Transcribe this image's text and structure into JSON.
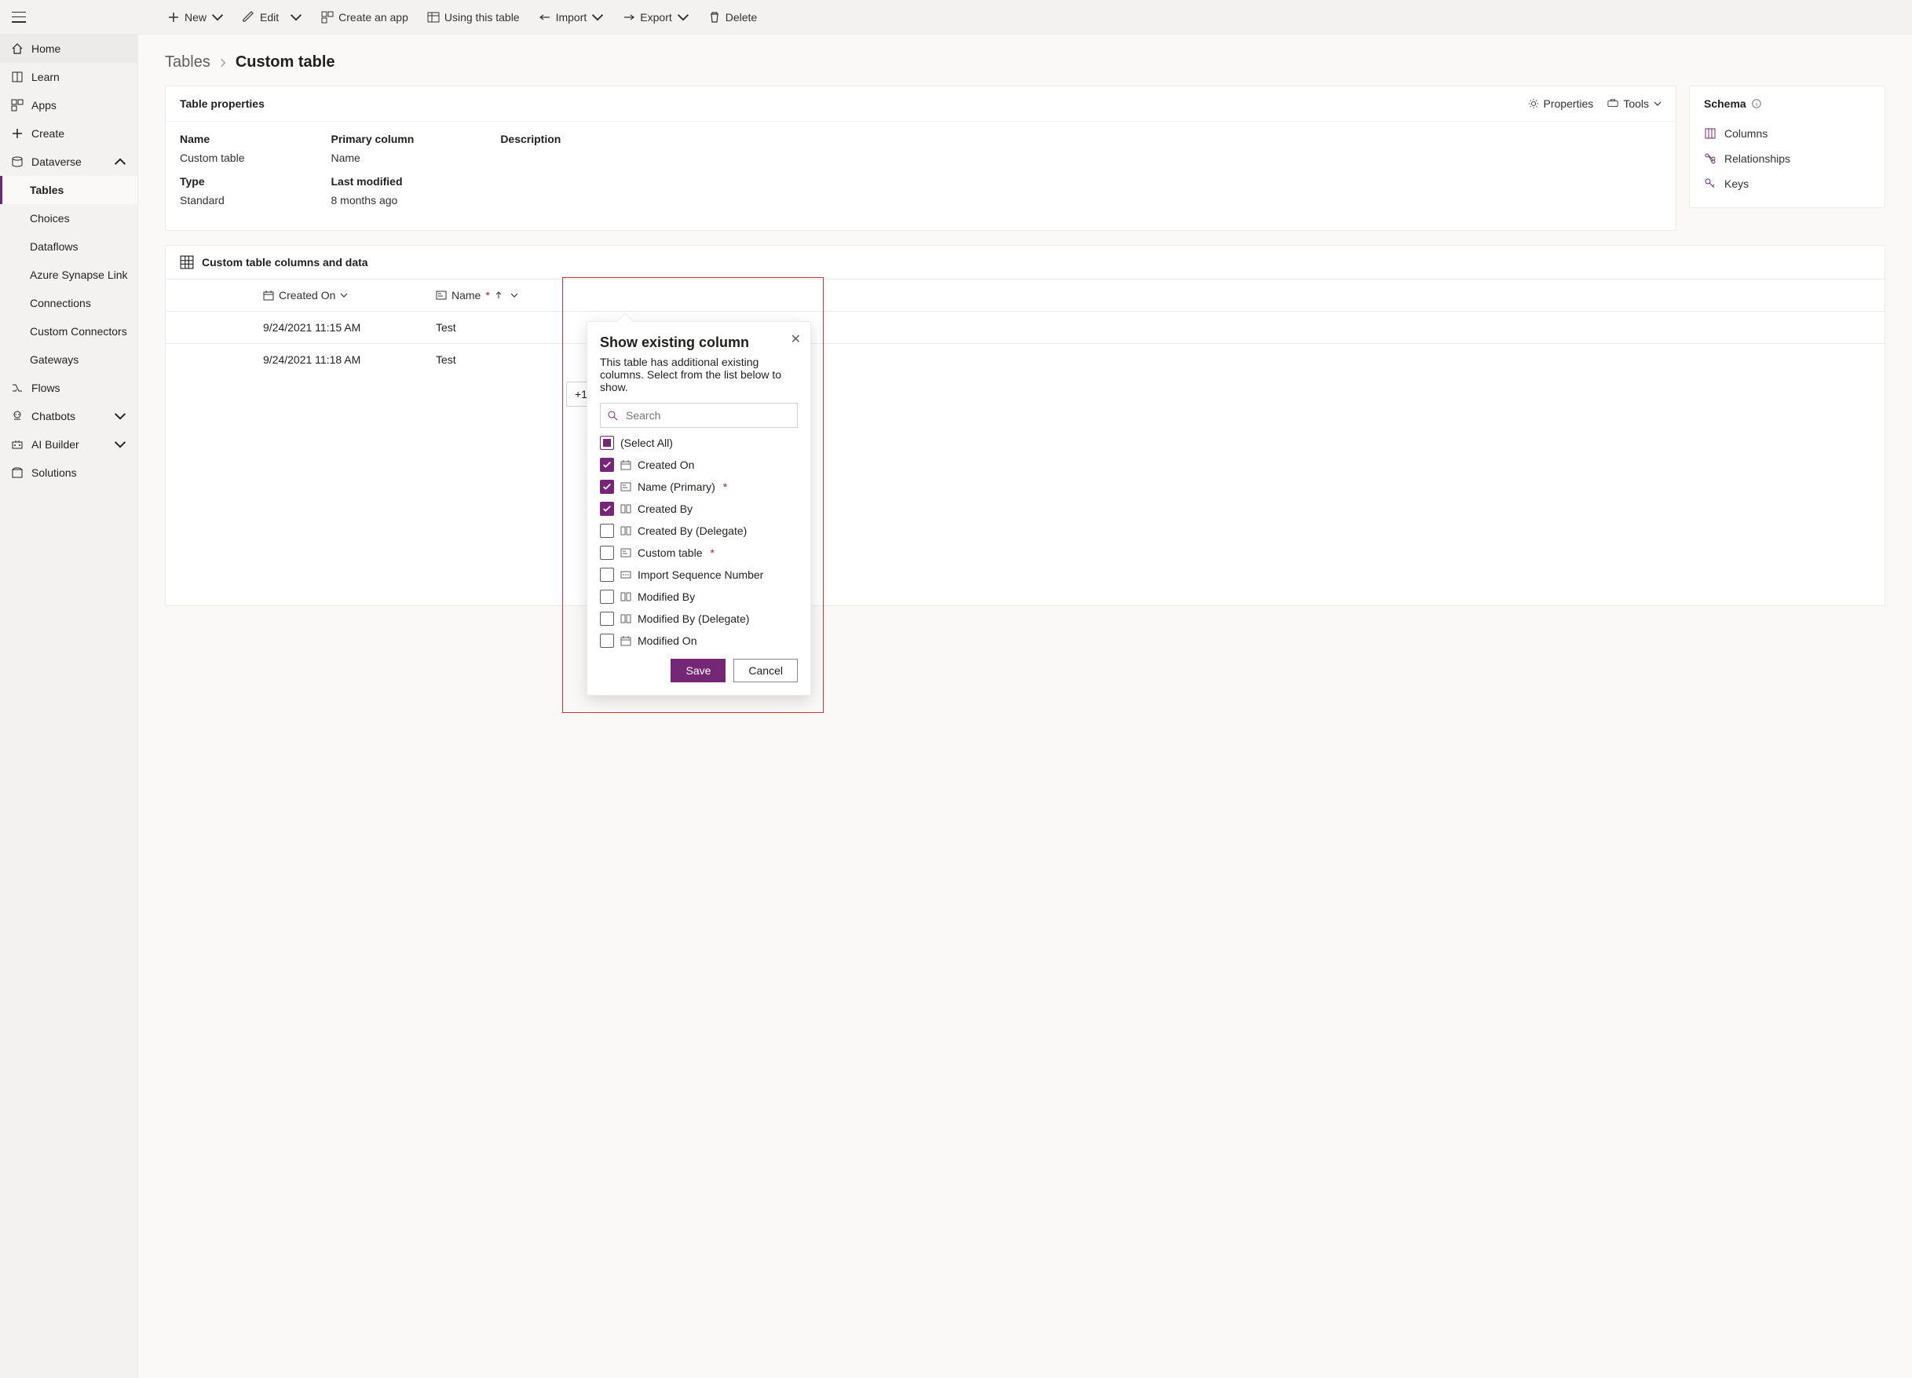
{
  "toolbar": {
    "new": "New",
    "edit": "Edit",
    "create_app": "Create an app",
    "using_table": "Using this table",
    "import": "Import",
    "export": "Export",
    "delete": "Delete"
  },
  "nav": {
    "home": "Home",
    "learn": "Learn",
    "apps": "Apps",
    "create": "Create",
    "dataverse": "Dataverse",
    "tables": "Tables",
    "choices": "Choices",
    "dataflows": "Dataflows",
    "synapse": "Azure Synapse Link",
    "connections": "Connections",
    "custom_connectors": "Custom Connectors",
    "gateways": "Gateways",
    "flows": "Flows",
    "chatbots": "Chatbots",
    "ai_builder": "AI Builder",
    "solutions": "Solutions"
  },
  "breadcrumb": {
    "root": "Tables",
    "current": "Custom table"
  },
  "props": {
    "title": "Table properties",
    "properties_btn": "Properties",
    "tools_btn": "Tools",
    "name_label": "Name",
    "name_val": "Custom table",
    "primary_label": "Primary column",
    "primary_val": "Name",
    "desc_label": "Description",
    "desc_val": "",
    "type_label": "Type",
    "type_val": "Standard",
    "lastmod_label": "Last modified",
    "lastmod_val": "8 months ago"
  },
  "schema": {
    "title": "Schema",
    "columns": "Columns",
    "relationships": "Relationships",
    "keys": "Keys"
  },
  "data": {
    "header": "Custom table columns and data",
    "col_created_on": "Created On",
    "col_name": "Name",
    "more_label": "+17 more",
    "rows": [
      {
        "created": "9/24/2021 11:15 AM",
        "name": "Test"
      },
      {
        "created": "9/24/2021 11:18 AM",
        "name": "Test"
      }
    ]
  },
  "popup": {
    "title": "Show existing column",
    "desc": "This table has additional existing columns. Select from the list below to show.",
    "search_placeholder": "Search",
    "select_all": "(Select All)",
    "items": [
      {
        "label": "Created On",
        "checked": true,
        "icon": "date"
      },
      {
        "label": "Name (Primary)",
        "checked": true,
        "icon": "text",
        "required": true
      },
      {
        "label": "Created By",
        "checked": true,
        "icon": "lookup"
      },
      {
        "label": "Created By (Delegate)",
        "checked": false,
        "icon": "lookup"
      },
      {
        "label": "Custom table",
        "checked": false,
        "icon": "text",
        "required": true
      },
      {
        "label": "Import Sequence Number",
        "checked": false,
        "icon": "number"
      },
      {
        "label": "Modified By",
        "checked": false,
        "icon": "lookup"
      },
      {
        "label": "Modified By (Delegate)",
        "checked": false,
        "icon": "lookup"
      },
      {
        "label": "Modified On",
        "checked": false,
        "icon": "date"
      }
    ],
    "save": "Save",
    "cancel": "Cancel"
  }
}
